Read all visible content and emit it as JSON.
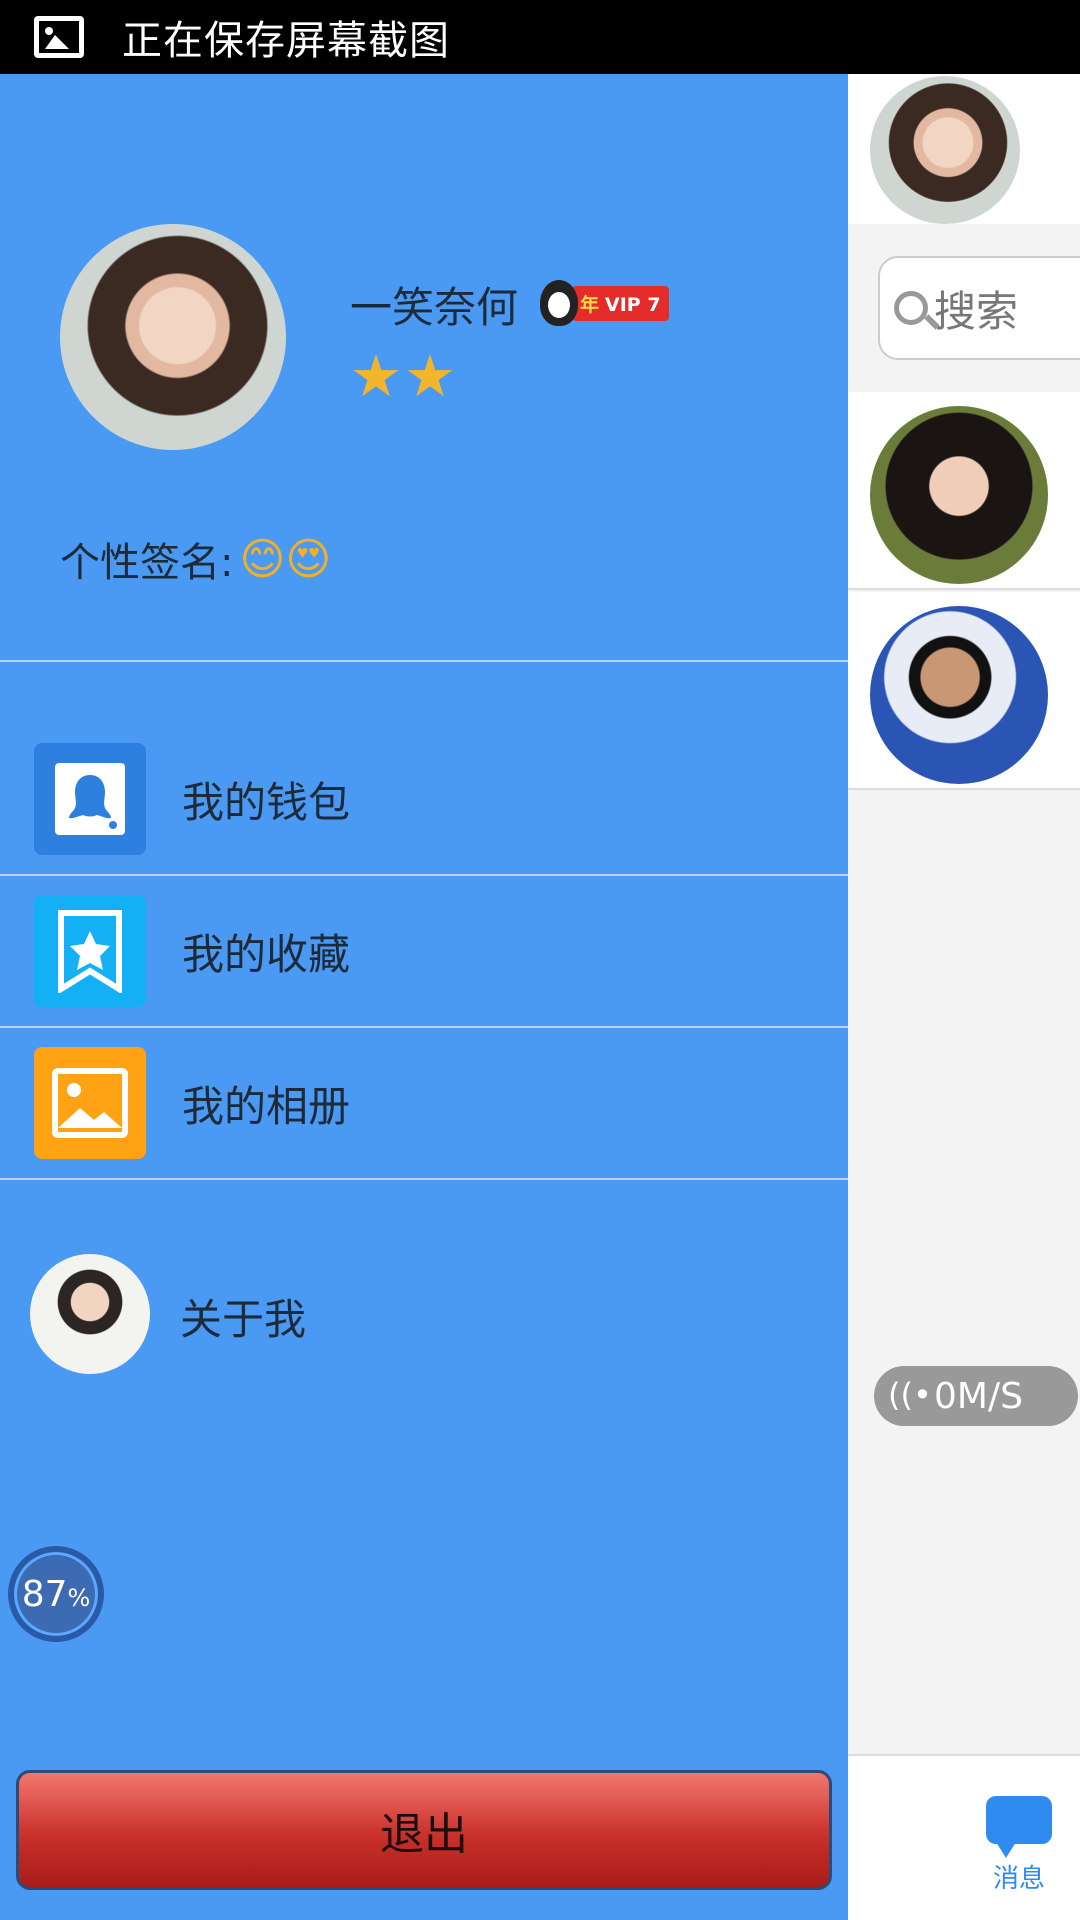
{
  "status_bar": {
    "text": "正在保存屏幕截图",
    "icon": "image-icon"
  },
  "profile": {
    "username": "一笑奈何",
    "vip_year": "年",
    "vip_level": "VIP 7",
    "stars": "★★",
    "signature_label": "个性签名:",
    "signature_emoji": "😊😍"
  },
  "menu": [
    {
      "label": "我的钱包",
      "icon": "wallet-icon",
      "color": "#2D7FE0"
    },
    {
      "label": "我的收藏",
      "icon": "favorite-icon",
      "color": "#13B0F5"
    },
    {
      "label": "我的相册",
      "icon": "album-icon",
      "color": "#FFA214"
    }
  ],
  "about": {
    "label": "关于我"
  },
  "progress": {
    "value": "87",
    "unit": "%"
  },
  "logout": {
    "label": "退出"
  },
  "main": {
    "search_placeholder": "搜索",
    "network_speed": "0M/S",
    "bottom_tab_label": "消息"
  },
  "colors": {
    "drawer_bg": "#4A9AF3",
    "accent": "#2E8CF0",
    "logout": "#C9302A"
  }
}
